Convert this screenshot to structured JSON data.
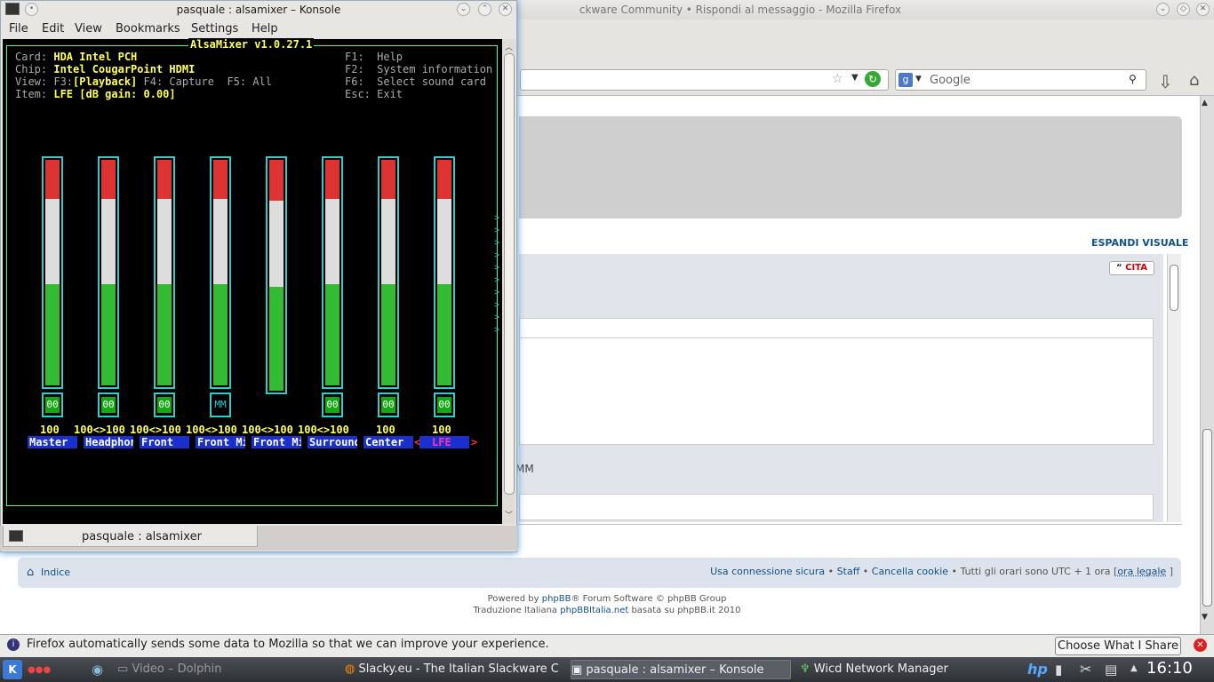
{
  "firefox": {
    "title_visible": "ckware Community • Rispondi al messaggio - Mozilla Firefox",
    "search_placeholder": "Google",
    "espandi": "ESPANDI VISUALE",
    "cita": "CITA",
    "mm_text": "MM",
    "indice": "Indice",
    "footer_links": {
      "secure": "Usa connessione sicura",
      "staff": "Staff",
      "cookies": "Cancella cookie",
      "timezone": "Tutti gli orari sono UTC + 1 ora [",
      "legal": "ora legale",
      "close_bracket": "]",
      "sep": " • "
    },
    "powered": {
      "prefix": "Powered by ",
      "phpbb": "phpBB",
      "suffix": "® Forum Software © phpBB Group",
      "trad_prefix": "Traduzione Italiana ",
      "phpbbitalia": "phpBBItalia.net",
      "trad_suffix": " basata su phpBB.it 2010"
    },
    "notification": "Firefox automatically sends some data to Mozilla so that we can improve your experience.",
    "choose_button": "Choose What I Share"
  },
  "konsole": {
    "title": "pasquale : alsamixer – Konsole",
    "menu": [
      "File",
      "Edit",
      "View",
      "Bookmarks",
      "Settings",
      "Help"
    ],
    "tab_label": "pasquale : alsamixer"
  },
  "alsamixer": {
    "title": " AlsaMixer v1.0.27.1 ",
    "card_label": "Card: ",
    "card_value": "HDA Intel PCH",
    "chip_label": "Chip: ",
    "chip_value": "Intel CougarPoint HDMI",
    "view_label": "View: F3:",
    "view_playback": "[Playback]",
    "view_rest": " F4: Capture  F5: All",
    "item_label": "Item: ",
    "item_value": "LFE [dB gain: 0.00]",
    "keys": [
      "F1:  Help",
      "F2:  System information",
      "F6:  Select sound card",
      "Esc: Exit"
    ],
    "channels": [
      {
        "name": "Master",
        "volume": "100",
        "switch": "00",
        "level": 1.0
      },
      {
        "name": "Headphon",
        "volume": "100<>100",
        "switch": "00",
        "level": 1.0
      },
      {
        "name": "Front",
        "volume": "100<>100",
        "switch": "00",
        "level": 1.0
      },
      {
        "name": "Front Mi",
        "volume": "100<>100",
        "switch": "MM",
        "level": 1.0
      },
      {
        "name": "Front Mi",
        "volume": "100<>100",
        "switch": "",
        "level": 1.0
      },
      {
        "name": "Surround",
        "volume": "100<>100",
        "switch": "00",
        "level": 1.0
      },
      {
        "name": "Center",
        "volume": "100",
        "switch": "00",
        "level": 1.0
      },
      {
        "name": "LFE",
        "volume": "100",
        "switch": "00",
        "level": 1.0
      }
    ],
    "sel_left": "<",
    "sel_right": ">",
    "more_arrow": ">"
  },
  "taskbar": {
    "tasks": [
      "Video – Dolphin",
      "Slacky.eu - The Italian Slackware Co",
      "pasquale : alsamixer – Konsole",
      "Wicd Network Manager"
    ],
    "clock": "16:10"
  },
  "colors": {
    "accent": "#105289",
    "term_cyan": "#33cccc",
    "term_yellow": "#ffff55",
    "label_blue": "#1a2fcf"
  }
}
